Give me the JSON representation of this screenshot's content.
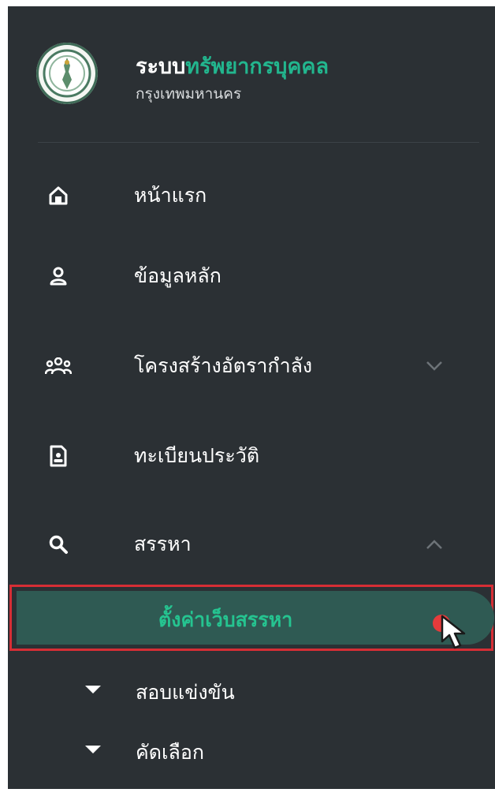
{
  "brand": {
    "title_part1": "ระบบ",
    "title_part2": "ทรัพยากรบุคคล",
    "subtitle": "กรุงเทพมหานคร"
  },
  "nav": {
    "items": [
      {
        "label": "หน้าแรก",
        "icon": "home-icon"
      },
      {
        "label": "ข้อมูลหลัก",
        "icon": "user-icon"
      },
      {
        "label": "โครงสร้างอัตรากำลัง",
        "icon": "users-group-icon",
        "expanded": false
      },
      {
        "label": "ทะเบียนประวัติ",
        "icon": "profile-document-icon"
      },
      {
        "label": "สรรหา",
        "icon": "search-icon",
        "expanded": true
      }
    ],
    "subitems": [
      {
        "label": "ตั้งค่าเว็บสรรหา",
        "active": true
      },
      {
        "label": "สอบแข่งขัน"
      },
      {
        "label": "คัดเลือก"
      }
    ]
  },
  "colors": {
    "sidebar_bg": "#2b3034",
    "accent_green": "#22b68e",
    "active_bg": "#2f5a53",
    "highlight_border": "#d62e35"
  }
}
